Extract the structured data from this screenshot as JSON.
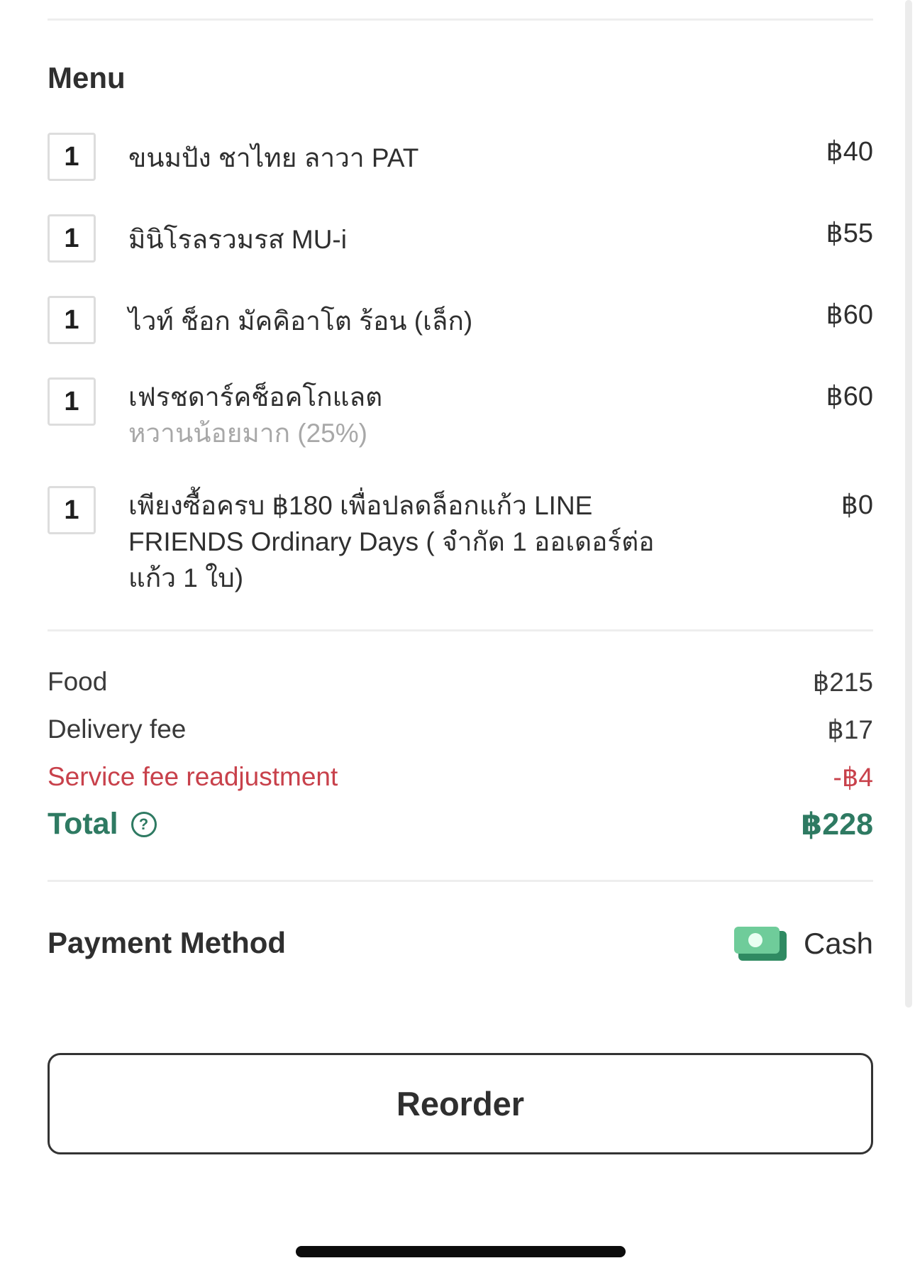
{
  "menu": {
    "title": "Menu",
    "items": [
      {
        "qty": "1",
        "name": "ขนมปัง ชาไทย ลาวา PAT",
        "option": "",
        "price": "฿40"
      },
      {
        "qty": "1",
        "name": "มินิโรลรวมรส MU-i",
        "option": "",
        "price": "฿55"
      },
      {
        "qty": "1",
        "name": "ไวท์ ช็อก มัคคิอาโต ร้อน (เล็ก)",
        "option": "",
        "price": "฿60"
      },
      {
        "qty": "1",
        "name": "เฟรชดาร์คช็อคโกแลต",
        "option": "หวานน้อยมาก (25%)",
        "price": "฿60"
      },
      {
        "qty": "1",
        "name": "เพียงซื้อครบ ฿180 เพื่อปลดล็อกแก้ว LINE FRIENDS Ordinary Days ( จำกัด 1 ออเดอร์ต่อแก้ว 1 ใบ)",
        "option": "",
        "price": "฿0"
      }
    ]
  },
  "summary": {
    "food_label": "Food",
    "food_value": "฿215",
    "delivery_label": "Delivery fee",
    "delivery_value": "฿17",
    "adjust_label": "Service fee readjustment",
    "adjust_value": "-฿4",
    "total_label": "Total",
    "total_help": "?",
    "total_value": "฿228"
  },
  "payment": {
    "label": "Payment Method",
    "method": "Cash",
    "icon": "cash-icon"
  },
  "actions": {
    "reorder_label": "Reorder"
  },
  "colors": {
    "accent_green": "#2e7a62",
    "adjust_red": "#c8414b"
  }
}
